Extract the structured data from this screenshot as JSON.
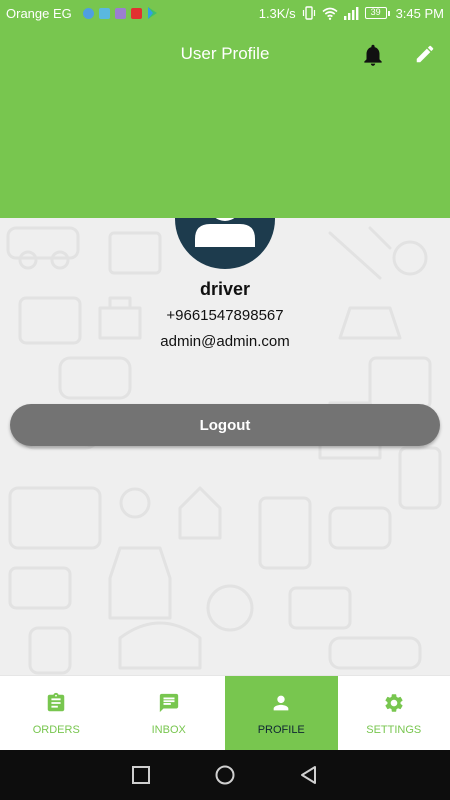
{
  "status_bar": {
    "carrier": "Orange EG",
    "net_speed": "1.3K/s",
    "battery": "39",
    "time": "3:45 PM"
  },
  "header": {
    "title": "User Profile",
    "bell_icon": "bell-icon",
    "edit_icon": "edit-icon"
  },
  "profile": {
    "name": "driver",
    "phone": "+9661547898567",
    "email": "admin@admin.com",
    "logout_label": "Logout"
  },
  "bottom_nav": {
    "items": [
      {
        "label": "ORDERS",
        "icon": "clipboard-icon"
      },
      {
        "label": "INBOX",
        "icon": "message-icon"
      },
      {
        "label": "PROFILE",
        "icon": "person-icon",
        "active": true
      },
      {
        "label": "SETTINGS",
        "icon": "gear-icon"
      }
    ]
  },
  "colors": {
    "accent": "#78c64f",
    "avatar_bg": "#1d3b4d",
    "logout_bg": "#737373",
    "active_nav_text": "#0f2633"
  }
}
